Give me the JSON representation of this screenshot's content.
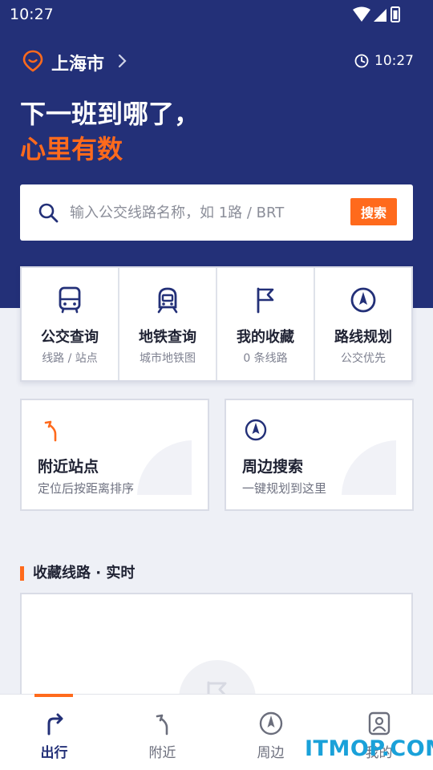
{
  "status_bar": {
    "time": "10:27"
  },
  "header": {
    "city": "上海市",
    "clock_time": "10:27",
    "headline_line1": "下一班到哪了，",
    "headline_line2": "心里有数"
  },
  "search": {
    "placeholder": "输入公交线路名称，如 1路 / BRT",
    "button_label": "搜索"
  },
  "quick_actions": [
    {
      "title": "公交查询",
      "subtitle": "线路 / 站点",
      "icon": "bus-icon"
    },
    {
      "title": "地铁查询",
      "subtitle": "城市地铁图",
      "icon": "subway-icon"
    },
    {
      "title": "我的收藏",
      "subtitle": "0 条线路",
      "icon": "flag-icon"
    },
    {
      "title": "路线规划",
      "subtitle": "公交优先",
      "icon": "compass-icon"
    }
  ],
  "cards": [
    {
      "title": "附近站点",
      "subtitle": "定位后按距离排序",
      "icon": "turn-arrow-icon"
    },
    {
      "title": "周边搜索",
      "subtitle": "一键规划到这里",
      "icon": "compass-icon"
    }
  ],
  "favorites": {
    "section_title": "收藏线路 · 实时"
  },
  "tab_bar": [
    {
      "label": "出行",
      "icon": "route-icon",
      "active": true
    },
    {
      "label": "附近",
      "icon": "turn-arrow-icon",
      "active": false
    },
    {
      "label": "周边",
      "icon": "compass-icon",
      "active": false
    },
    {
      "label": "我的",
      "icon": "profile-icon",
      "active": false
    }
  ],
  "watermark": "ITMOP.COM",
  "colors": {
    "primary": "#233078",
    "accent": "#ff6a1c",
    "background": "#eef0f6"
  }
}
